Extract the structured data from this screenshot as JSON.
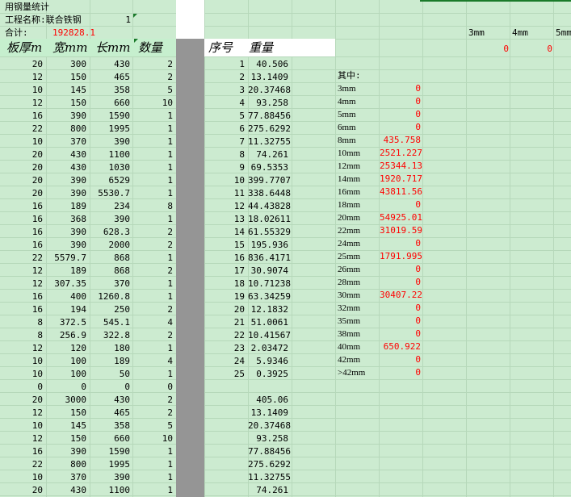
{
  "header": {
    "title": "用钢量统计",
    "project_label": "工程名称:联合铁钢",
    "project_count": "1",
    "total_label": "合计:",
    "total_value": "192828.1"
  },
  "columns": {
    "thickness": "板厚m",
    "width": "宽mm",
    "length": "长mm",
    "quantity": "数量",
    "seq": "序号",
    "weight": "重量"
  },
  "right_header": {
    "mm3": "3mm",
    "mm4": "4mm",
    "mm5": "5mm",
    "v1": "0",
    "v2": "0"
  },
  "rows": [
    [
      "20",
      "300",
      "430",
      "2",
      "1",
      "40.506"
    ],
    [
      "12",
      "150",
      "465",
      "2",
      "2",
      "13.1409"
    ],
    [
      "10",
      "145",
      "358",
      "5",
      "3",
      "20.37468"
    ],
    [
      "12",
      "150",
      "660",
      "10",
      "4",
      "93.258"
    ],
    [
      "16",
      "390",
      "1590",
      "1",
      "5",
      "77.88456"
    ],
    [
      "22",
      "800",
      "1995",
      "1",
      "6",
      "275.6292"
    ],
    [
      "10",
      "370",
      "390",
      "1",
      "7",
      "11.32755"
    ],
    [
      "20",
      "430",
      "1100",
      "1",
      "8",
      "74.261"
    ],
    [
      "20",
      "430",
      "1030",
      "1",
      "9",
      "69.5353"
    ],
    [
      "20",
      "390",
      "6529",
      "1",
      "10",
      "399.7707"
    ],
    [
      "20",
      "390",
      "5530.7",
      "1",
      "11",
      "338.6448"
    ],
    [
      "16",
      "189",
      "234",
      "8",
      "12",
      "44.43828"
    ],
    [
      "16",
      "368",
      "390",
      "1",
      "13",
      "18.02611"
    ],
    [
      "16",
      "390",
      "628.3",
      "2",
      "14",
      "61.55329"
    ],
    [
      "16",
      "390",
      "2000",
      "2",
      "15",
      "195.936"
    ],
    [
      "22",
      "5579.7",
      "868",
      "1",
      "16",
      "836.4171"
    ],
    [
      "12",
      "189",
      "868",
      "2",
      "17",
      "30.9074"
    ],
    [
      "12",
      "307.35",
      "370",
      "1",
      "18",
      "10.71238"
    ],
    [
      "16",
      "400",
      "1260.8",
      "1",
      "19",
      "63.34259"
    ],
    [
      "16",
      "194",
      "250",
      "2",
      "20",
      "12.1832"
    ],
    [
      "8",
      "372.5",
      "545.1",
      "4",
      "21",
      "51.0061"
    ],
    [
      "8",
      "256.9",
      "322.8",
      "2",
      "22",
      "10.41567"
    ],
    [
      "12",
      "120",
      "180",
      "1",
      "23",
      "2.03472"
    ],
    [
      "10",
      "100",
      "189",
      "4",
      "24",
      "5.9346"
    ],
    [
      "10",
      "100",
      "50",
      "1",
      "25",
      "0.3925"
    ],
    [
      "0",
      "0",
      "0",
      "0",
      "",
      ""
    ],
    [
      "20",
      "3000",
      "430",
      "2",
      "",
      "405.06"
    ],
    [
      "12",
      "150",
      "465",
      "2",
      "",
      "13.1409"
    ],
    [
      "10",
      "145",
      "358",
      "5",
      "",
      "20.37468"
    ],
    [
      "12",
      "150",
      "660",
      "10",
      "",
      "93.258"
    ],
    [
      "16",
      "390",
      "1590",
      "1",
      "",
      "77.88456"
    ],
    [
      "22",
      "800",
      "1995",
      "1",
      "",
      "275.6292"
    ],
    [
      "10",
      "370",
      "390",
      "1",
      "",
      "11.32755"
    ],
    [
      "20",
      "430",
      "1100",
      "1",
      "",
      "74.261"
    ]
  ],
  "summary": {
    "label": "其中:",
    "items": [
      [
        "3mm",
        "0"
      ],
      [
        "4mm",
        "0"
      ],
      [
        "5mm",
        "0"
      ],
      [
        "6mm",
        "0"
      ],
      [
        "8mm",
        "435.758"
      ],
      [
        "10mm",
        "2521.227"
      ],
      [
        "12mm",
        "25344.13"
      ],
      [
        "14mm",
        "1920.717"
      ],
      [
        "16mm",
        "43811.56"
      ],
      [
        "18mm",
        "0"
      ],
      [
        "20mm",
        "54925.01"
      ],
      [
        "22mm",
        "31019.59"
      ],
      [
        "24mm",
        "0"
      ],
      [
        "25mm",
        "1791.995"
      ],
      [
        "26mm",
        "0"
      ],
      [
        "28mm",
        "0"
      ],
      [
        "30mm",
        "30407.22"
      ],
      [
        "32mm",
        "0"
      ],
      [
        "35mm",
        "0"
      ],
      [
        "38mm",
        "0"
      ],
      [
        "40mm",
        "650.922"
      ],
      [
        "42mm",
        "0"
      ],
      [
        ">42mm",
        "0"
      ]
    ]
  }
}
